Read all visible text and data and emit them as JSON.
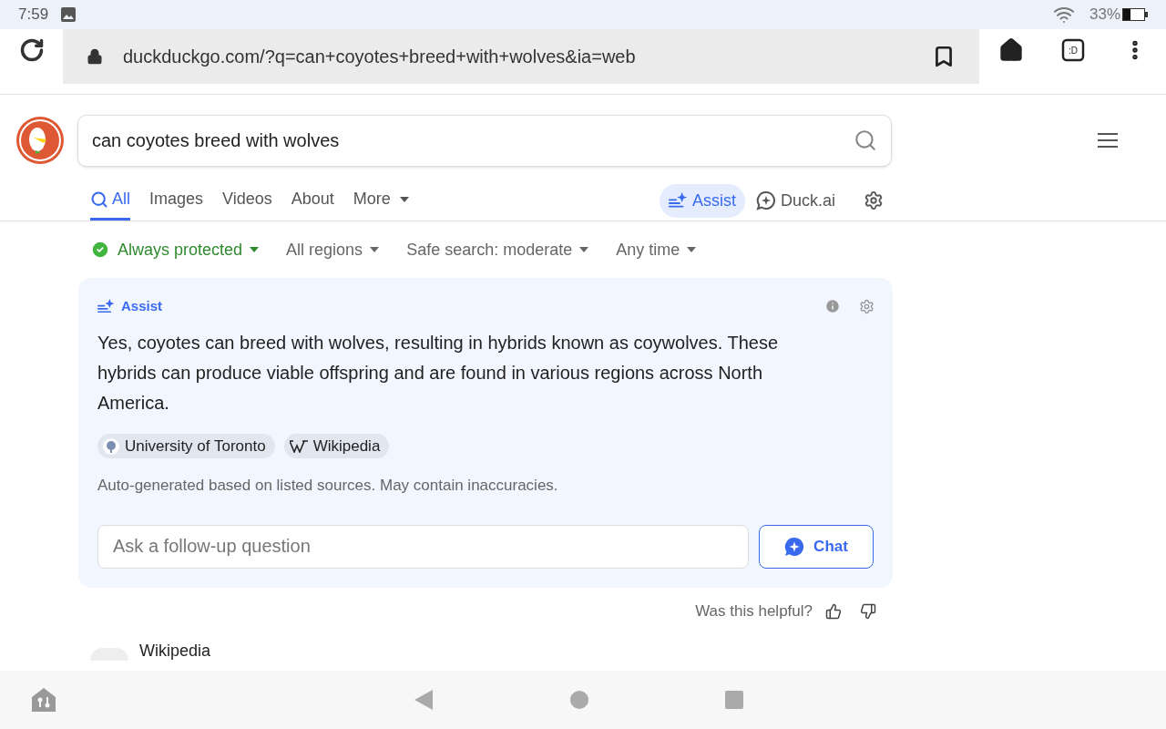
{
  "status_bar": {
    "time": "7:59",
    "battery": "33%"
  },
  "browser": {
    "url": "duckduckgo.com/?q=can+coyotes+breed+with+wolves&ia=web",
    "tab_switcher": ":D"
  },
  "search": {
    "value": "can coyotes breed with wolves"
  },
  "tabs": [
    {
      "label": "All",
      "selected": true,
      "menu": false
    },
    {
      "label": "Images",
      "selected": false,
      "menu": false
    },
    {
      "label": "Videos",
      "selected": false,
      "menu": false
    },
    {
      "label": "About",
      "selected": false,
      "menu": false
    },
    {
      "label": "More",
      "selected": false,
      "menu": true
    }
  ],
  "assist_button": {
    "label": "Assist",
    "selected": true
  },
  "duck_ai": {
    "label": "Duck.ai"
  },
  "filters": [
    {
      "label": "Always protected",
      "kind": "protection"
    },
    {
      "label": "All regions",
      "kind": "dropdown"
    },
    {
      "label": "Safe search: moderate",
      "kind": "dropdown"
    },
    {
      "label": "Any time",
      "kind": "dropdown"
    }
  ],
  "assist_card": {
    "title": "Assist",
    "answer": "Yes, coyotes can breed with wolves, resulting in hybrids known as coywolves. These hybrids can produce viable offspring and are found in various regions across North America.",
    "sources": [
      {
        "label": "University of Toronto",
        "kind": "crest"
      },
      {
        "label": "Wikipedia",
        "kind": "wiki"
      }
    ],
    "note": "Auto-generated based on listed sources. May contain inaccuracies.",
    "followup": {
      "placeholder": "Ask a follow-up question"
    },
    "chat_button": "Chat"
  },
  "feedback": {
    "question": "Was this helpful?"
  },
  "result": {
    "source": "Wikipedia"
  }
}
